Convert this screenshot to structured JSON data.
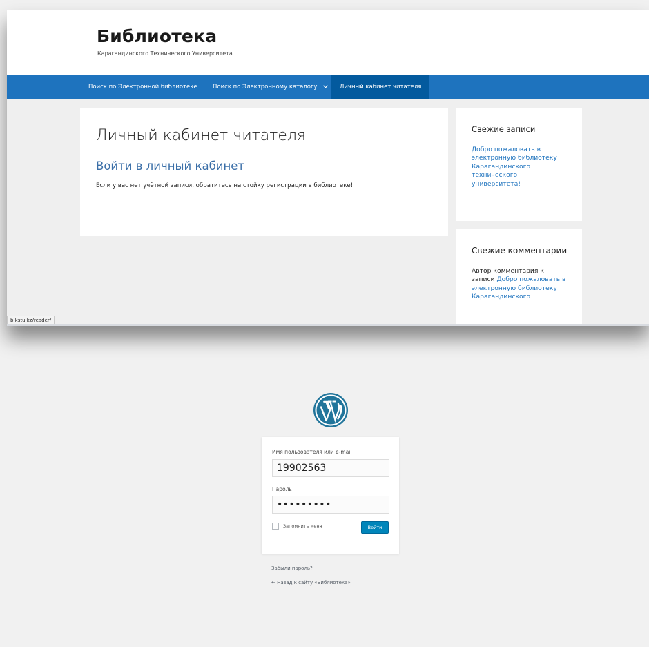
{
  "site": {
    "title": "Библиотека",
    "description": "Карагандинского Технического Университета"
  },
  "nav": {
    "items": [
      {
        "label": "Поиск по Электронной библиотеке"
      },
      {
        "label": "Поиск по Электронному каталогу",
        "icon": "chevron-down-icon"
      },
      {
        "label": "Личный кабинет читателя",
        "active": true
      }
    ]
  },
  "content": {
    "page_title": "Личный кабинет читателя",
    "login_link": "Войти в личный кабинет",
    "notice": "Если у вас нет учётной записи, обратитесь на стойку регистрации в библиотеке!"
  },
  "sidebar": {
    "recent_posts": {
      "title": "Свежие записи",
      "post": "Добро пожаловать в электронную библиотеку Карагандинского технического университета!"
    },
    "recent_comments": {
      "title": "Свежие комментарии",
      "author": "Автор комментария",
      "connector": "к записи",
      "post": "Добро пожаловать в электронную библиотеку Карагандинского"
    }
  },
  "status_bar": {
    "url": "b.kstu.kz/reader/"
  },
  "login": {
    "logo_icon": "wordpress-logo-icon",
    "username_label": "Имя пользователя или e-mail",
    "username_value": "19902563",
    "password_label": "Пароль",
    "password_value": "•••••••••",
    "remember_label": "Запомнить меня",
    "submit_label": "Войти",
    "lost_password": "Забыли пароль?",
    "back_to_site": "← Назад к сайту «Библиотека»"
  },
  "colors": {
    "nav_bg": "#1e73be",
    "nav_active_bg": "#035a9e",
    "link": "#1e73be",
    "wp_blue": "#21759b",
    "button_blue": "#0085ba"
  }
}
